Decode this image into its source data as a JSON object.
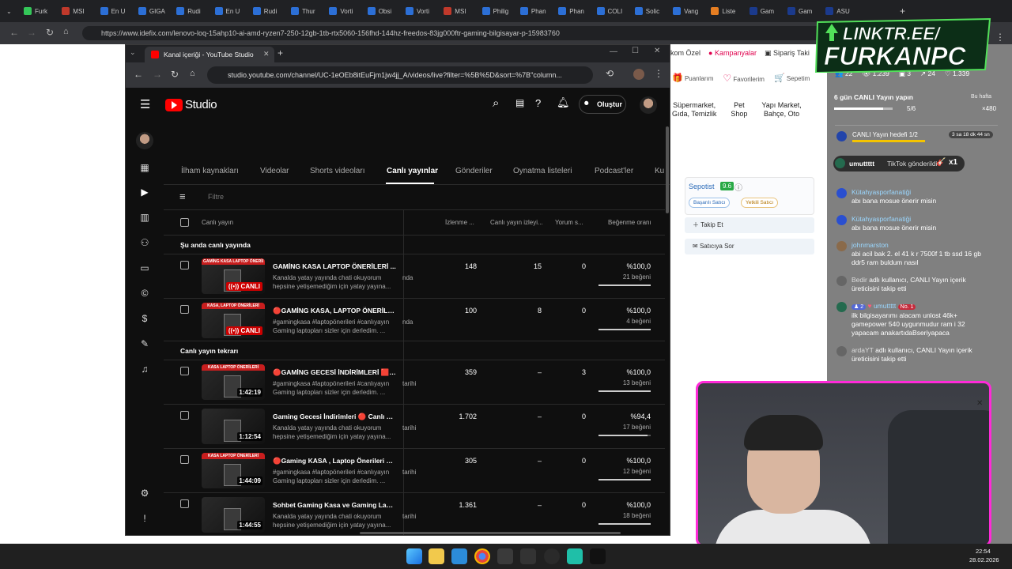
{
  "outer_browser": {
    "tabs": [
      "Furk",
      "MSI",
      "En U",
      "GIGA",
      "Rudi",
      "En U",
      "Rudi",
      "Thur",
      "Vorti",
      "Obsi",
      "Vorti",
      "MSI",
      "Philig",
      "Phan",
      "Phan",
      "COLI",
      "Solic",
      "Vang",
      "Liste",
      "Gam",
      "Gam",
      "ASU"
    ],
    "url": "https://www.idefix.com/lenovo-loq-15ahp10-ai-amd-ryzen7-250-12gb-1tb-rtx5060-156fhd-144hz-freedos-83jg000ftr-gaming-bilgisayar-p-15983760"
  },
  "idefix": {
    "top_links": [
      "kom Özel",
      "Kampanyalar",
      "Sipariş Taki"
    ],
    "icons": [
      "Puanlarım",
      "Favorilerim",
      "Sepetim"
    ],
    "categories": [
      {
        "line1": "Süpermarket,",
        "line2": "Gıda, Temizlik"
      },
      {
        "line1": "Pet",
        "line2": "Shop"
      },
      {
        "line1": "Yapı Market,",
        "line2": "Bahçe, Oto"
      }
    ],
    "seller_name": "Sepotist",
    "seller_score": "9.6",
    "badges": [
      "Başarılı Satıcı",
      "Yetkili Satıcı"
    ],
    "follow_button": "Takip Et",
    "ask_button": "Satıcıya Sor"
  },
  "inner_browser": {
    "tab_title": "Kanal içeriği - YouTube Studio",
    "url": "studio.youtube.com/channel/UC-1eOEb8itEuFjm1jw4jj_A/videos/live?filter=%5B%5D&sort=%7B\"column..."
  },
  "studio": {
    "logo_text": "Studio",
    "create_button": "Oluştur",
    "tabs": [
      "İlham kaynakları",
      "Videolar",
      "Shorts videoları",
      "Canlı yayınlar",
      "Gönderiler",
      "Oynatma listeleri",
      "Podcast'ler",
      "Ku"
    ],
    "filter_placeholder": "Filtre",
    "columns": {
      "video": "Canlı yayın",
      "views": "İzlenme ...",
      "concurrent": "Canlı yayın izleyi...",
      "comments": "Yorum s...",
      "likes": "Beğenme oranı"
    },
    "section_live": "Şu anda canlı yayında",
    "section_replay": "Canlı yayın tekrarı",
    "live_badge": "CANLI",
    "live_rows": [
      {
        "title": "GAMİNG KASA LAPTOP ÖNERİLERİ ...",
        "desc1": "Kanalda yatay yayında chati okuyorum",
        "desc2": "hepsine yetişemediğim için yatay yayına...",
        "side": "nda",
        "views": "148",
        "concurrent": "15",
        "comments": "0",
        "pct": "%100,0",
        "likes": "21 beğeni",
        "thumb_text": "GAMİNG KASA LAPTOP ÖNERİLERİ"
      },
      {
        "title": "🔴GAMİNG KASA, LAPTOP ÖNERİLE...",
        "desc1": "#gamingkasa #laptopönerileri #canlıyayın",
        "desc2": "Gaming laptopları sizler için derledim. ...",
        "side": "nda",
        "views": "100",
        "concurrent": "8",
        "comments": "0",
        "pct": "%100,0",
        "likes": "4 beğeni",
        "thumb_text": "KASA, LAPTOP ÖNERİLERİ"
      }
    ],
    "replay_rows": [
      {
        "title": "🔴GAMİNG GECESİ İNDİRİMLERİ 🟥C...",
        "desc1": "#gamingkasa #laptopönerileri #canlıyayın",
        "desc2": "Gaming laptopları sizler için derledim. ...",
        "side": "tarihi",
        "duration": "1:42:19",
        "views": "359",
        "concurrent": "–",
        "comments": "3",
        "pct": "%100,0",
        "likes": "13 beğeni",
        "ratio": 1.0,
        "thumb_text": "KASA LAPTOP ÖNERİLERİ"
      },
      {
        "title": "Gaming Gecesi İndirimleri 🔴 Canlı Ya...",
        "desc1": "Kanalda yatay yayında chati okuyorum",
        "desc2": "hepsine yetişemediğim için yatay yayına...",
        "side": "tarihi",
        "duration": "1:12:54",
        "views": "1.702",
        "concurrent": "–",
        "comments": "0",
        "pct": "%94,4",
        "likes": "17 beğeni",
        "ratio": 0.944,
        "thumb_text": ""
      },
      {
        "title": "🔴Gaming KASA , Laptop Önerileri 🟥...",
        "desc1": "#gamingkasa #laptopönerileri #canlıyayın",
        "desc2": "Gaming laptopları sizler için derledim. ...",
        "side": "tarihi",
        "duration": "1:44:09",
        "views": "305",
        "concurrent": "–",
        "comments": "0",
        "pct": "%100,0",
        "likes": "12 beğeni",
        "ratio": 1.0,
        "thumb_text": "KASA LAPTOP ÖNERİLERİ"
      },
      {
        "title": "Sohbet Gaming Kasa ve Gaming Lapt...",
        "desc1": "Kanalda yatay yayında chati okuyorum",
        "desc2": "hepsine yetişemediğim için yatay yayına...",
        "side": "tarihi",
        "duration": "1:44:55",
        "views": "1.361",
        "concurrent": "–",
        "comments": "0",
        "pct": "%100,0",
        "likes": "18 beğeni",
        "ratio": 1.0,
        "thumb_text": ""
      }
    ]
  },
  "overlay": {
    "logo_line1": "LINKTR.EE/",
    "logo_line2": "FURKANPC",
    "stats": [
      "22",
      "1.239",
      "3",
      "24",
      "1.339"
    ],
    "goal_text": "6 gün CANLI Yayın yapın",
    "goal_week": "Bu hafta",
    "goal_progress": "5/6",
    "goal_reward": "×480",
    "goal2_text": "CANLI Yayın hedefi 1/2",
    "goal2_time": "3 sa 18 dk 44 sn",
    "gift_user": "umuttttt",
    "gift_text": "TikTok gönderildi",
    "gift_count": "x1",
    "chat": [
      {
        "user": "Kütahyasporfanatiği",
        "text": "abı bana mosue önerir misin"
      },
      {
        "user": "Kütahyasporfanatiği",
        "text": "abı bana mosue önerir misin"
      },
      {
        "user": "johnmarston",
        "text": "abi acil bak 2. el 41 k r 7500f 1 tb ssd 16 gb ddr5 ram buldum nasıl"
      },
      {
        "user": "Bedir",
        "text": "adlı kullanıcı, CANLI Yayın içerik üreticisini takip etti"
      },
      {
        "user": "umuttttt",
        "text": "ilk bilgisayarımı alacam unlost 46k+ gamepower 540 uygunmudur ram i 32 yapacam anakartıdaBseriyapaca"
      },
      {
        "user": "ardaYT",
        "text": "adlı kullanıcı, CANLI Yayın içerik üreticisini takip etti"
      }
    ],
    "chat_badge_num": "2",
    "chat_badge_no1": "No. 1"
  },
  "taskbar": {
    "time": "22:54",
    "date": "28.02.2026"
  },
  "colors": {
    "yt_red": "#ff0000",
    "accent_green": "#52e05a",
    "overlay_pink": "#ff2ad8"
  }
}
